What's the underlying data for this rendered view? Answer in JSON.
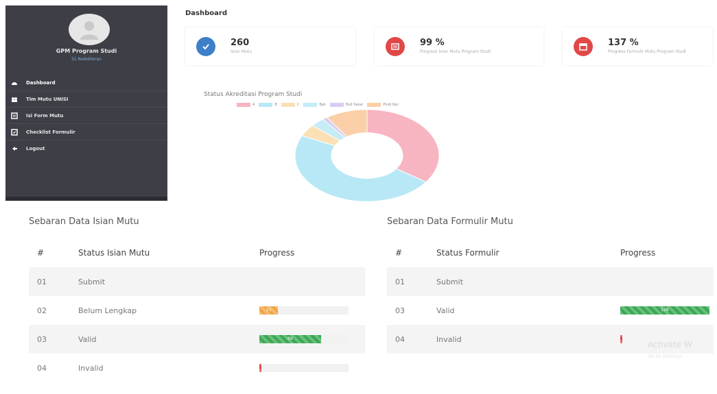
{
  "sidebar": {
    "profile_name": "GPM Program Studi",
    "profile_sub": "S1 Kedokteran",
    "items": [
      {
        "label": "Dashboard",
        "icon": "dashboard-icon"
      },
      {
        "label": "Tim Mutu UNISI",
        "icon": "users-icon"
      },
      {
        "label": "Isi Form Mutu",
        "icon": "form-icon"
      },
      {
        "label": "Checklist Formulir",
        "icon": "checklist-icon"
      },
      {
        "label": "Logout",
        "icon": "logout-icon"
      }
    ]
  },
  "header": {
    "title": "Dashboard"
  },
  "cards": [
    {
      "value": "260",
      "label": "Isian Mutu",
      "color": "#3d7fc9",
      "icon": "check-icon"
    },
    {
      "value": "99 %",
      "label": "Progress Isian Mutu Program Studi",
      "color": "#e04848",
      "icon": "chart-icon"
    },
    {
      "value": "137 %",
      "label": "Progress Formulir Mutu Program Studi",
      "color": "#e04848",
      "icon": "calendar-icon"
    }
  ],
  "donut": {
    "title": "Status Akreditasi Program Studi",
    "legend": [
      "A",
      "B",
      "C",
      "Bpk",
      "Bub Sekar",
      "Pindi Kpc"
    ],
    "colors": [
      "#f7b5c1",
      "#b8e8f5",
      "#fbe0b5",
      "#c6ecf6",
      "#d8cdf0",
      "#fbd0a8"
    ],
    "values": [
      33,
      45,
      4,
      3,
      1,
      9
    ]
  },
  "table_isian": {
    "title": "Sebaran Data Isian Mutu",
    "headers": [
      "#",
      "Status Isian Mutu",
      "Progress"
    ],
    "rows": [
      {
        "num": "01",
        "status": "Submit",
        "progress": 0,
        "bar_label": "",
        "color": "none"
      },
      {
        "num": "02",
        "status": "Belum Lengkap",
        "progress": 21,
        "bar_label": "21",
        "color": "orange"
      },
      {
        "num": "03",
        "status": "Valid",
        "progress": 69,
        "bar_label": "69",
        "color": "green"
      },
      {
        "num": "04",
        "status": "Invalid",
        "progress": 2,
        "bar_label": "",
        "color": "red"
      }
    ]
  },
  "table_formulir": {
    "title": "Sebaran Data Formulir Mutu",
    "headers": [
      "#",
      "Status Formulir",
      "Progress"
    ],
    "rows": [
      {
        "num": "01",
        "status": "Submit",
        "progress": 0,
        "bar_label": "",
        "color": "none"
      },
      {
        "num": "03",
        "status": "Valid",
        "progress": 100,
        "bar_label": "128",
        "color": "green"
      },
      {
        "num": "04",
        "status": "Invalid",
        "progress": 2,
        "bar_label": "",
        "color": "red"
      }
    ]
  },
  "watermark": {
    "line1": "Activate W",
    "line2": "Go to Settings"
  }
}
